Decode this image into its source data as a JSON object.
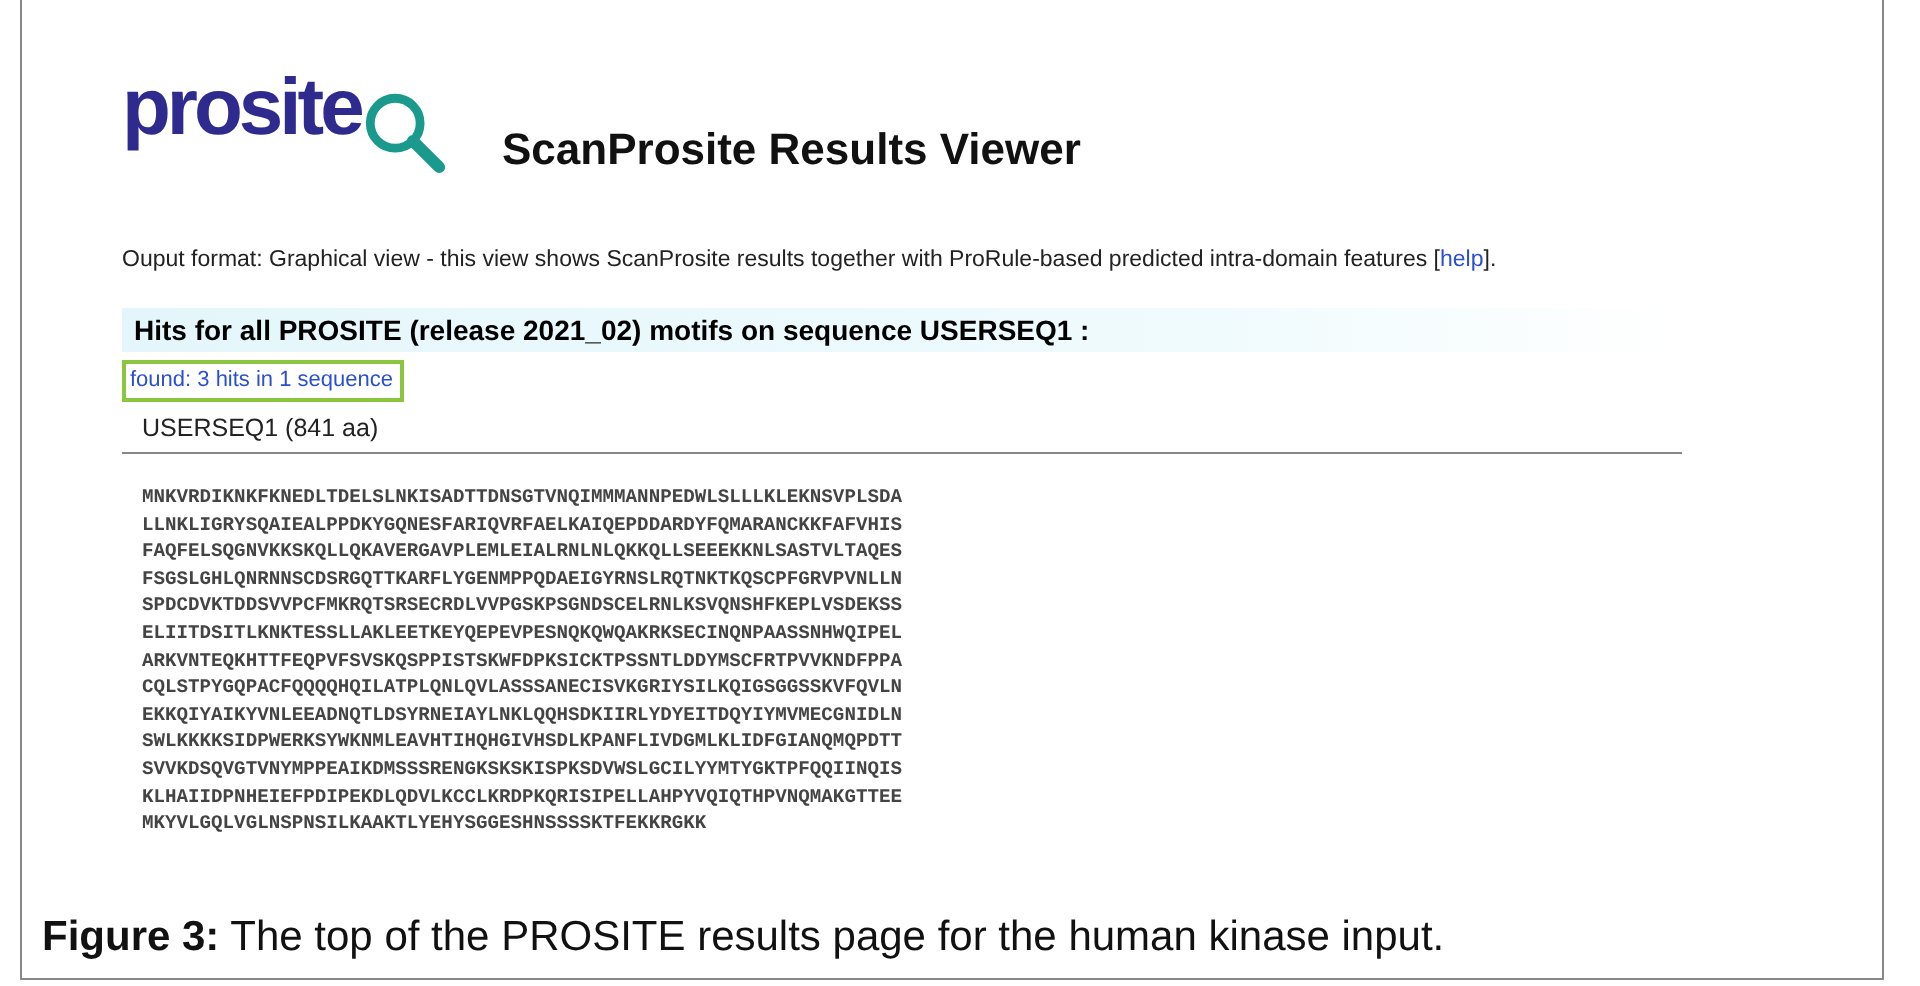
{
  "logo": {
    "text": "prosite"
  },
  "title": "ScanProsite Results Viewer",
  "description": {
    "text": "Ouput format: Graphical view - this view shows ScanProsite results together with ProRule-based predicted intra-domain features [",
    "link": "help",
    "after": "]."
  },
  "hits_header": "Hits for all PROSITE (release 2021_02) motifs on sequence USERSEQ1 :",
  "found_link": "found: 3 hits in 1 sequence",
  "sequence": {
    "name": "USERSEQ1 (841 aa)",
    "lines": [
      "MNKVRDIKNKFKNEDLTDELSLNKISADTTDNSGTVNQIMMMANNPEDWLSLLLKLEKNSVPLSDA",
      "LLNKLIGRYSQAIEALPPDKYGQNESFARIQVRFAELKAIQEPDDARDYFQMARANCKKFAFVHIS",
      "FAQFELSQGNVKKSKQLLQKAVERGAVPLEMLEIALRNLNLQKKQLLSEEEKKNLSASTVLTAQES",
      "FSGSLGHLQNRNNSCDSRGQTTKARFLYGENMPPQDAEIGYRNSLRQTNKTKQSCPFGRVPVNLLN",
      "SPDCDVKTDDSVVPCFMKRQTSRSECRDLVVPGSKPSGNDSCELRNLKSVQNSHFKEPLVSDEKSS",
      "ELIITDSITLKNKTESSLLAKLEETKEYQEPEVPESNQKQWQAKRKSECINQNPAASSNHWQIPEL",
      "ARKVNTEQKHTTFEQPVFSVSKQSPPISTSKWFDPKSICKTPSSNTLDDYMSCFRTPVVKNDFPPA",
      "CQLSTPYGQPACFQQQQHQILATPLQNLQVLASSSANECISVKGRIYSILKQIGSGGSSKVFQVLN",
      "EKKQIYAIKYVNLEEADNQTLDSYRNEIAYLNKLQQHSDKIIRLYDYEITDQYIYMVMECGNIDLN",
      "SWLKKKKSIDPWERKSYWKNMLEAVHTIHQHGIVHSDLKPANFLIVDGMLKLIDFGIANQMQPDTT",
      "SVVKDSQVGTVNYMPPEAIKDMSSSRENGKSKSKISPKSDVWSLGCILYYMTYGKTPFQQIINQIS",
      "KLHAIIDPNHEIEFPDIPEKDLQDVLKCCLKRDPKQRISIPELLAHPYVQIQTHPVNQMAKGTTEE",
      "MKYVLGQLVGLNSPNSILKAAKTLYEHYSGGESHNSSSSKTFEKKRGKK"
    ]
  },
  "caption": "**Figure 3:** The top of the PROSITE results page for the human kinase input."
}
